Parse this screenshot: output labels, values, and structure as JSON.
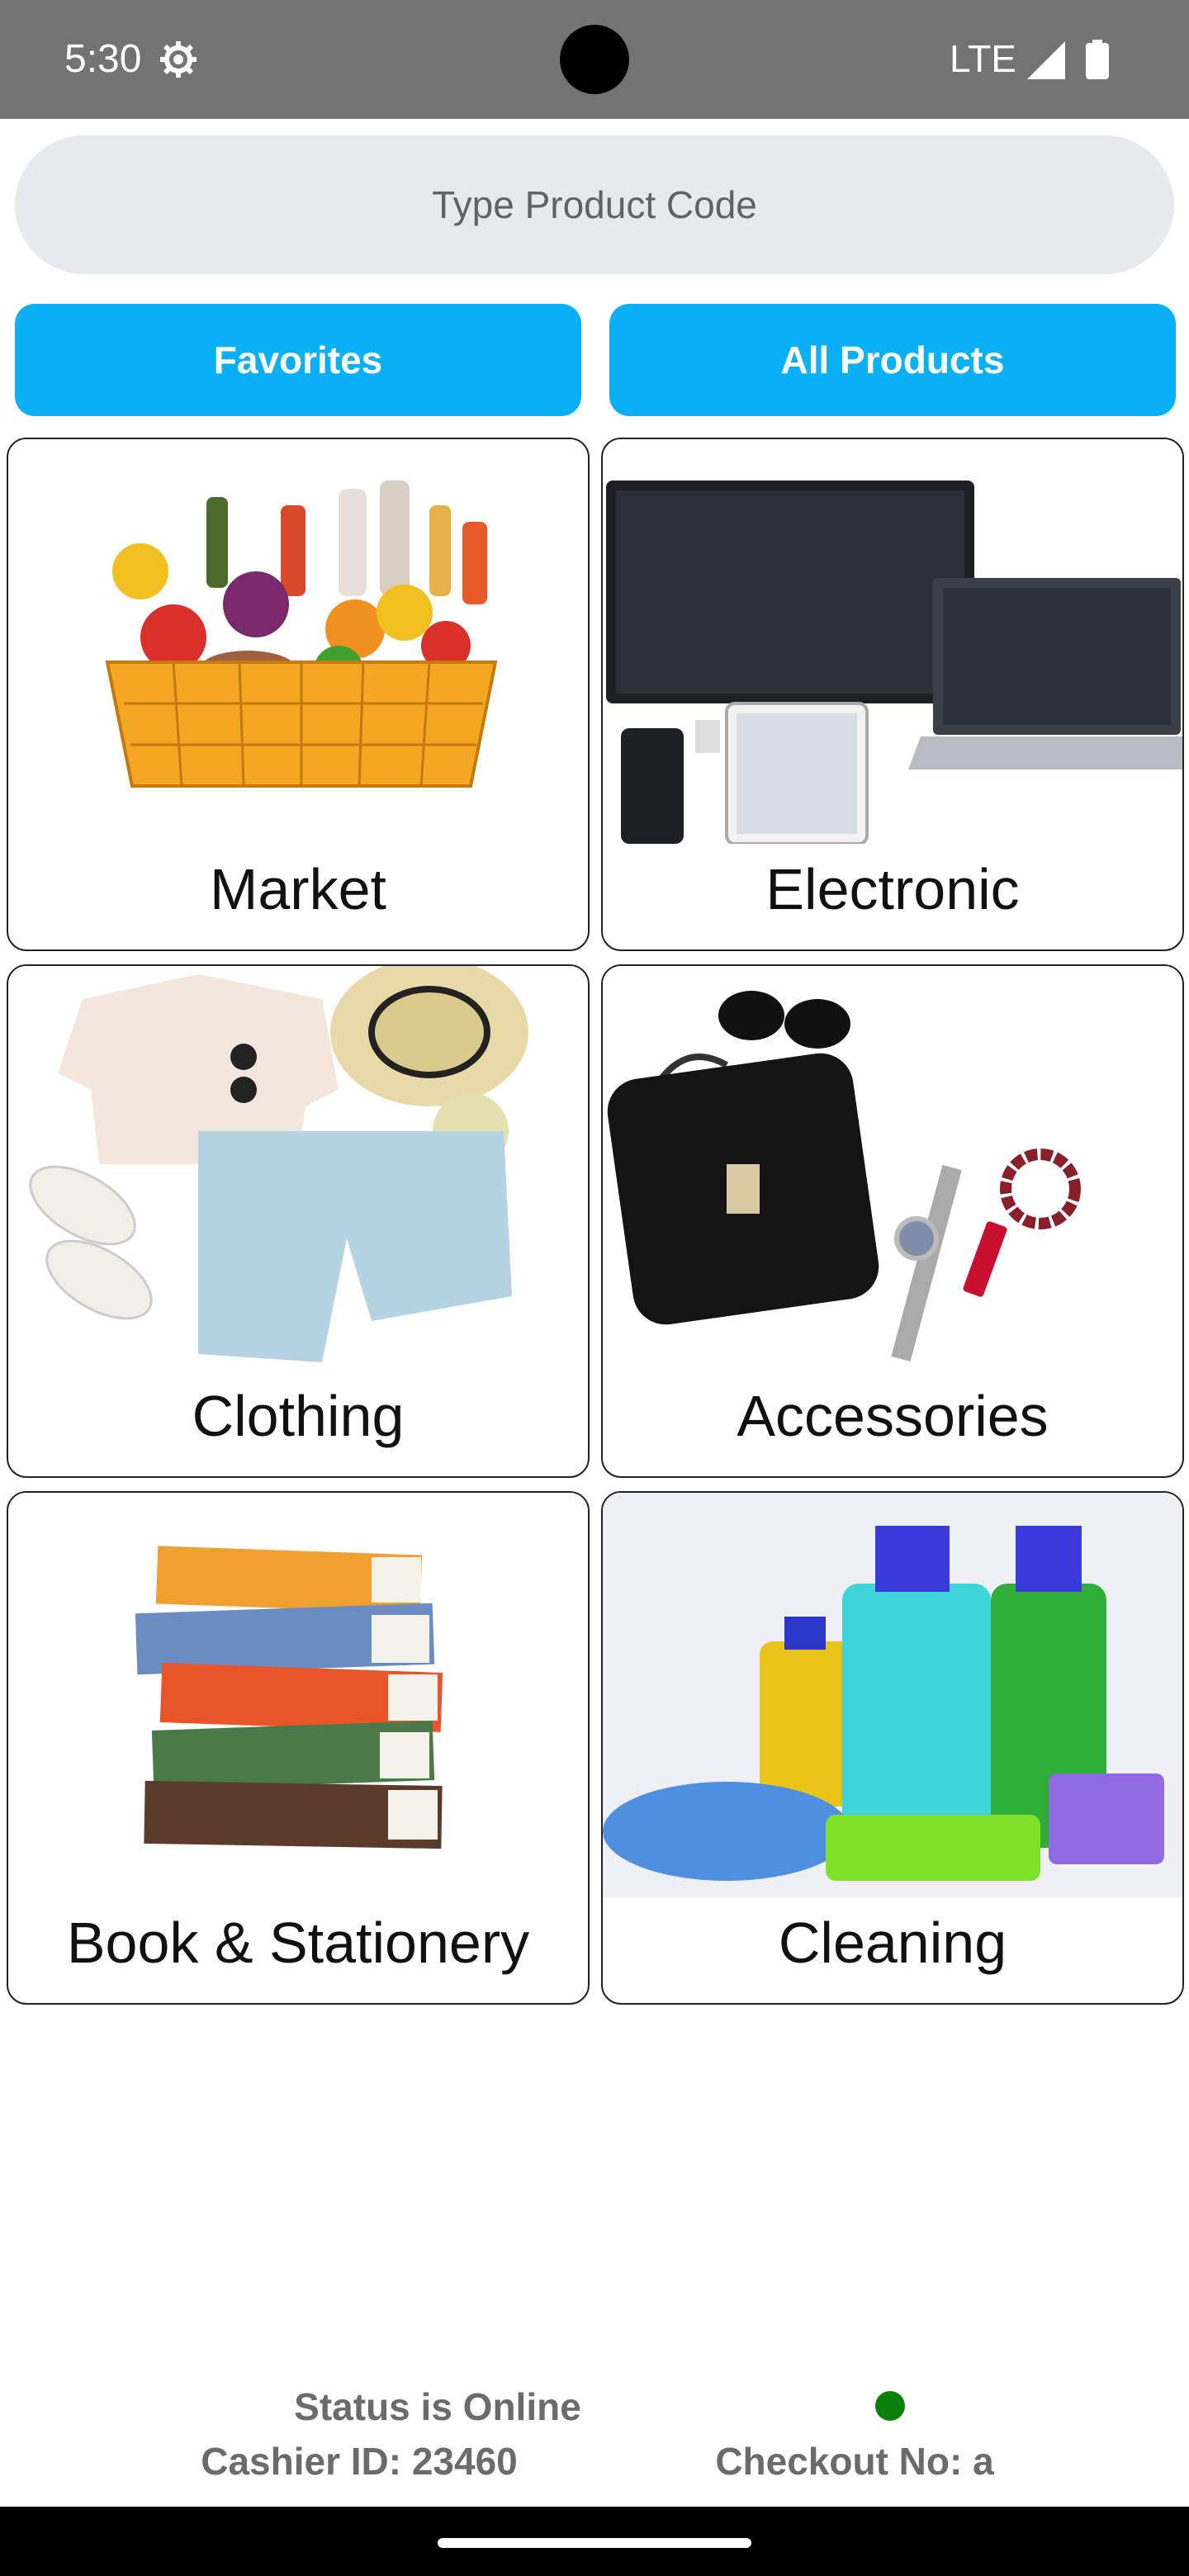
{
  "status_bar": {
    "time": "5:30",
    "network": "LTE",
    "icons": [
      "gear-icon",
      "signal-icon",
      "battery-icon"
    ]
  },
  "search": {
    "placeholder": "Type Product Code"
  },
  "tabs": [
    {
      "label": "Favorites"
    },
    {
      "label": "All Products"
    }
  ],
  "accent_color": "#0ab0f5",
  "categories": [
    {
      "label": "Market",
      "image": "grocery-basket"
    },
    {
      "label": "Electronic",
      "image": "electronics-devices"
    },
    {
      "label": "Clothing",
      "image": "clothing-items"
    },
    {
      "label": "Accessories",
      "image": "bag-and-accessories"
    },
    {
      "label": "Book & Stationery",
      "image": "stack-of-books"
    },
    {
      "label": "Cleaning",
      "image": "cleaning-supplies"
    }
  ],
  "footer": {
    "status": "Status is Online",
    "status_color": "#0a7f0a",
    "cashier": "Cashier ID: 23460",
    "checkout": "Checkout No: a"
  }
}
